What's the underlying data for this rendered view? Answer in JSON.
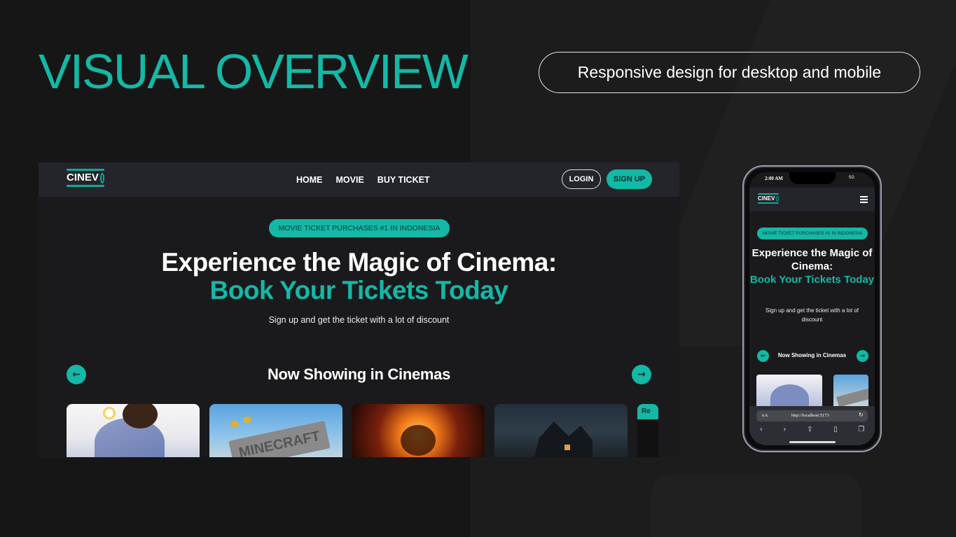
{
  "slide": {
    "title": "VISUAL OVERVIEW",
    "pill": "Responsive design for desktop and mobile"
  },
  "colors": {
    "accent": "#14b8a6",
    "background": "#161616",
    "nav": "#23252b"
  },
  "desktop": {
    "logo": "CINEV",
    "nav": [
      "HOME",
      "MOVIE",
      "BUY TICKET"
    ],
    "login": "LOGIN",
    "signup": "SIGN UP",
    "badge": "MOVIE TICKET PURCHASES #1 IN INDONESIA",
    "headline_1": "Experience the Magic of Cinema:",
    "headline_2": "Book Your Tickets Today",
    "subtitle": "Sign up and get the ticket with a lot of discount",
    "section_title": "Now Showing in Cinemas",
    "poster_text_minecraft": "MINECRAFT",
    "poster_badge_partial": "Re"
  },
  "mobile": {
    "time": "2:00 AM",
    "status": "5G",
    "logo": "CINEV",
    "badge": "MOVIE TICKET PURCHASES #1 IN INDONESIA",
    "headline_1": "Experience the Magic of Cinema:",
    "headline_2": "Book Your Tickets Today",
    "subtitle": "Sign up and get the ticket with a lot of discount",
    "section_title": "Now Showing in Cinemas",
    "url_aa": "AA",
    "url": "http://localhost:5173"
  }
}
